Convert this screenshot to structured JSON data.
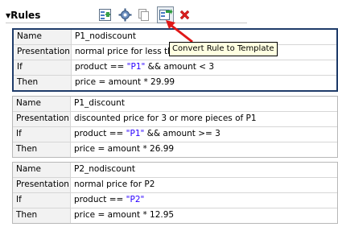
{
  "header": {
    "title": "Rules",
    "toolbar": [
      {
        "name": "add-rule-icon"
      },
      {
        "name": "settings-icon"
      },
      {
        "name": "copy-icon"
      },
      {
        "name": "convert-rule-icon"
      },
      {
        "name": "delete-icon"
      }
    ],
    "tooltip": "Convert Rule to Template"
  },
  "labels": {
    "name": "Name",
    "presentation": "Presentation",
    "if": "If",
    "then": "Then"
  },
  "rules": [
    {
      "name": "P1_nodiscount",
      "presentation": "normal price for less than",
      "if_pre": "product == ",
      "if_str": "\"P1\"",
      "if_post": " && amount < 3",
      "then": "price = amount * 29.99"
    },
    {
      "name": "P1_discount",
      "presentation": "discounted price for 3 or more pieces of P1",
      "if_pre": "product == ",
      "if_str": "\"P1\"",
      "if_post": " && amount >= 3",
      "then": "price = amount * 26.99"
    },
    {
      "name": "P2_nodiscount",
      "presentation": "normal price for P2",
      "if_pre": "product == ",
      "if_str": "\"P2\"",
      "if_post": "",
      "then": "price = amount * 12.95"
    }
  ],
  "colors": {
    "accent": "#1f3c6a",
    "string": "#2a00ff",
    "arrow": "#e01818",
    "tooltip_bg": "#ffffe1"
  }
}
